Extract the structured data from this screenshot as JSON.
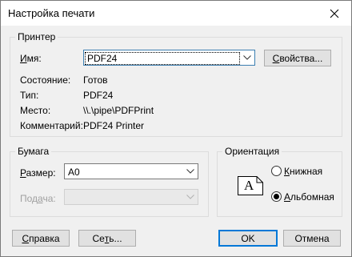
{
  "window": {
    "title": "Настройка печати",
    "close_icon": "close-icon"
  },
  "printer": {
    "group_label": "Принтер",
    "name_label_u": "И",
    "name_label_rest": "мя:",
    "name_value": "PDF24",
    "properties_button_u": "С",
    "properties_button_rest": "войства...",
    "rows": [
      {
        "label": "Состояние:",
        "value": "Готов"
      },
      {
        "label": "Тип:",
        "value": "PDF24"
      },
      {
        "label": "Место:",
        "value": "\\\\.\\pipe\\PDFPrint"
      },
      {
        "label": "Комментарий:",
        "value": "PDF24 Printer"
      }
    ]
  },
  "paper": {
    "group_label": "Бумага",
    "size_label_u": "Р",
    "size_label_rest": "азмер:",
    "size_value": "A0",
    "source_label_pre": "Под",
    "source_label_u": "а",
    "source_label_post": "ча:",
    "source_value": ""
  },
  "orientation": {
    "group_label": "Ориентация",
    "portrait_label_u": "К",
    "portrait_label_rest": "нижная",
    "landscape_label_u": "А",
    "landscape_label_rest": "льбомная",
    "selected": "landscape",
    "preview_letter": "A"
  },
  "buttons": {
    "help_u": "С",
    "help_rest": "правка",
    "network_pre": "Се",
    "network_u": "т",
    "network_post": "ь...",
    "ok": "OK",
    "cancel": "Отмена"
  }
}
